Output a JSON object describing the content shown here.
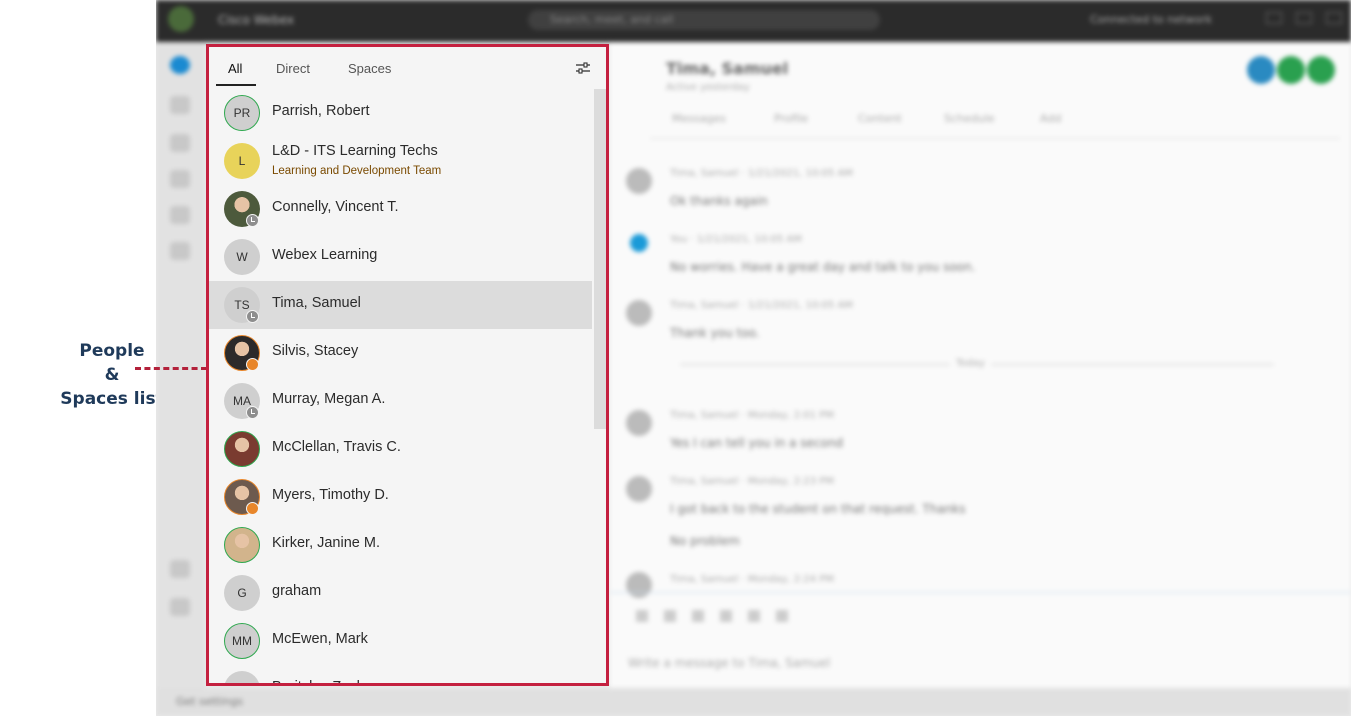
{
  "annotation": {
    "line1": "People",
    "line2": "&",
    "line3": "Spaces list",
    "border_color": "#c4203f"
  },
  "background_app": {
    "title": "Tima, Samuel",
    "window_label": "Cisco Webex",
    "search_placeholder": "Search, meet, and call",
    "status_text": "Connected to network",
    "chat_subtitle": "Active yesterday",
    "chat_tabs": [
      "Messages",
      "Profile",
      "Content",
      "Schedule",
      "Add"
    ],
    "messages": [
      {
        "meta": "Tima, Samuel  ·  1/21/2021, 10:05 AM",
        "text": "Ok thanks again"
      },
      {
        "meta": "You  ·  1/21/2021, 10:05 AM",
        "text": "No worries. Have a great day and talk to you soon."
      },
      {
        "meta": "Tima, Samuel  ·  1/21/2021, 10:05 AM",
        "text": "Thank you too."
      },
      {
        "meta": "Tima, Samuel  ·  Monday, 2:01 PM",
        "text": "Yes I can tell you in a second"
      },
      {
        "meta": "Tima, Samuel  ·  Monday, 2:23 PM",
        "text": "I got back to the student on that request. Thanks"
      },
      {
        "meta": "",
        "text": "No problem"
      },
      {
        "meta": "Tima, Samuel  ·  Monday, 2:24 PM",
        "text": ""
      }
    ],
    "divider_label": "Today",
    "composer_placeholder": "Write a message to Tima, Samuel",
    "bottom_label": "Get settings"
  },
  "panel": {
    "tabs": [
      {
        "label": "All",
        "active": true
      },
      {
        "label": "Direct",
        "active": false
      },
      {
        "label": "Spaces",
        "active": false
      }
    ],
    "filter_icon": "filter-sliders-icon",
    "items": [
      {
        "initials": "PR",
        "name": "Parrish, Robert",
        "avatar": "initials",
        "ring": "green",
        "status": ""
      },
      {
        "initials": "L",
        "name": "L&D - ITS Learning Techs",
        "subtitle": "Learning and Development Team",
        "avatar": "yellow",
        "ring": "",
        "status": ""
      },
      {
        "initials": "",
        "name": "Connelly, Vincent T.",
        "avatar": "photo",
        "ring": "",
        "status": "away-clock",
        "photo_color": "#4d5a3c"
      },
      {
        "initials": "W",
        "name": "Webex Learning",
        "avatar": "initials",
        "ring": "",
        "status": ""
      },
      {
        "initials": "TS",
        "name": "Tima, Samuel",
        "avatar": "initials",
        "ring": "",
        "status": "away-clock",
        "selected": true
      },
      {
        "initials": "",
        "name": "Silvis, Stacey",
        "avatar": "photo",
        "ring": "orange",
        "status": "orange",
        "photo_color": "#2c2a2a"
      },
      {
        "initials": "MA",
        "name": "Murray, Megan A.",
        "avatar": "initials",
        "ring": "",
        "status": "away-clock"
      },
      {
        "initials": "",
        "name": "McClellan, Travis C.",
        "avatar": "photo",
        "ring": "green",
        "status": "",
        "photo_color": "#7a3b30"
      },
      {
        "initials": "",
        "name": "Myers, Timothy D.",
        "avatar": "photo",
        "ring": "orange",
        "status": "orange",
        "photo_color": "#6d5a4e"
      },
      {
        "initials": "",
        "name": "Kirker, Janine M.",
        "avatar": "photo",
        "ring": "green",
        "status": "",
        "photo_color": "#d2b48c"
      },
      {
        "initials": "G",
        "name": "graham",
        "avatar": "initials",
        "ring": "",
        "status": ""
      },
      {
        "initials": "MM",
        "name": "McEwen, Mark",
        "avatar": "initials",
        "ring": "green",
        "status": ""
      },
      {
        "initials": "ZT",
        "name": "Breitzke, Zach",
        "avatar": "initials",
        "ring": "",
        "status": ""
      }
    ]
  }
}
